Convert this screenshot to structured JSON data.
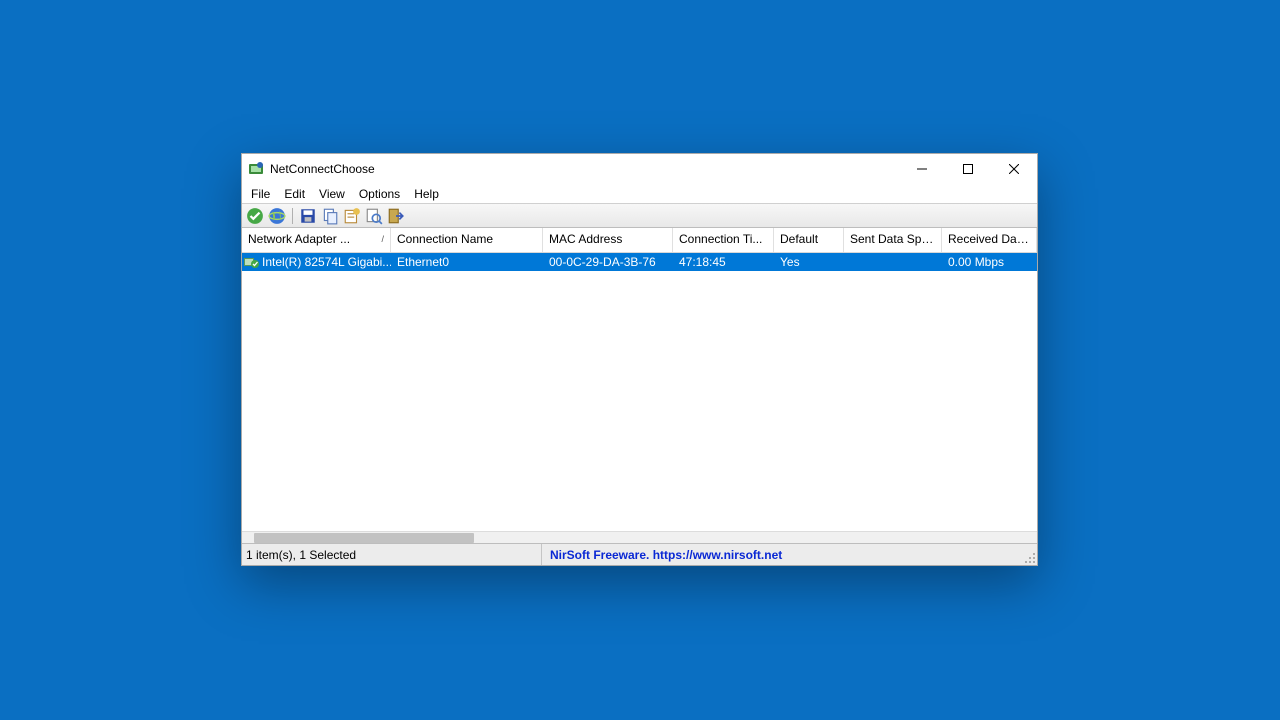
{
  "window": {
    "title": "NetConnectChoose"
  },
  "menu": {
    "file": "File",
    "edit": "Edit",
    "view": "View",
    "options": "Options",
    "help": "Help"
  },
  "columns": {
    "c0": "Network Adapter ...",
    "c1": "Connection Name",
    "c2": "MAC Address",
    "c3": "Connection Ti...",
    "c4": "Default",
    "c5": "Sent Data Speed",
    "c6": "Received Data ...",
    "sort_indicator": "/"
  },
  "rows": [
    {
      "adapter": "Intel(R) 82574L Gigabi...",
      "connection": "Ethernet0",
      "mac": "00-0C-29-DA-3B-76",
      "conntime": "47:18:45",
      "default": "Yes",
      "sent": "",
      "received": "0.00 Mbps"
    }
  ],
  "status": {
    "left": "1 item(s), 1 Selected",
    "right": "NirSoft Freeware. https://www.nirsoft.net"
  },
  "toolbar_icons": {
    "i0": "check-icon",
    "i1": "globe-icon",
    "i2": "save-icon",
    "i3": "copy-icon",
    "i4": "properties-icon",
    "i5": "find-icon",
    "i6": "exit-icon"
  }
}
